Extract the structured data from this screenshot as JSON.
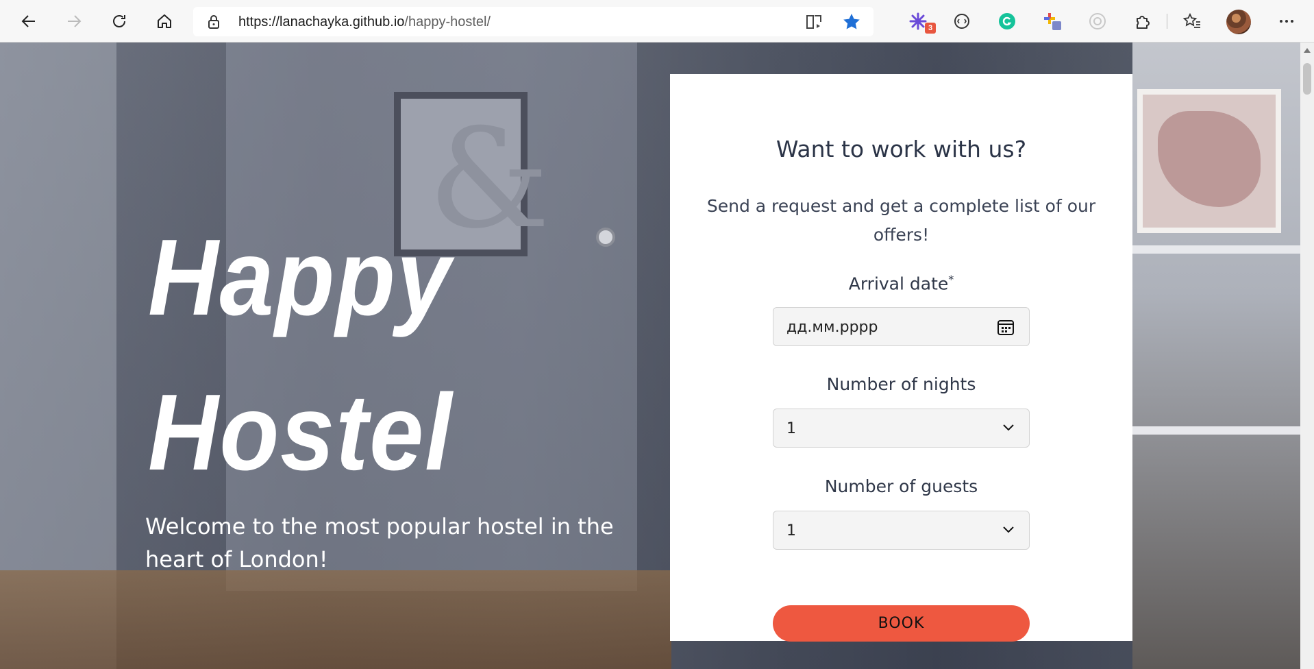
{
  "browser": {
    "url_main": "https://lanachayka.github.io",
    "url_path": "/happy-hostel/",
    "extension_badge": "3",
    "icons": [
      "back-icon",
      "forward-icon",
      "refresh-icon",
      "home-icon",
      "lock-icon",
      "immersive-reader-icon",
      "favorite-star-icon",
      "extension-badge-icon",
      "extension-circle-icon",
      "grammarly-icon",
      "extension-color-icon",
      "extension-gray-icon",
      "extensions-puzzle-icon",
      "favorites-icon",
      "profile-avatar",
      "more-menu-icon"
    ]
  },
  "hero": {
    "title_line1": "Happy",
    "title_line2": "Hostel",
    "subtitle": "Welcome to the most popular hostel in the heart of London!"
  },
  "form": {
    "heading": "Want to work with us?",
    "lead": "Send a request and get a complete list of our offers!",
    "arrival_label": "Arrival date",
    "arrival_required_mark": "*",
    "arrival_placeholder": "дд.мм.рррр",
    "nights_label": "Number of nights",
    "nights_value": "1",
    "guests_label": "Number of guests",
    "guests_value": "1",
    "book_label": "BOOK"
  },
  "colors": {
    "accent": "#ee5840",
    "star": "#1f6fd6",
    "text_dark": "#2b3447"
  }
}
